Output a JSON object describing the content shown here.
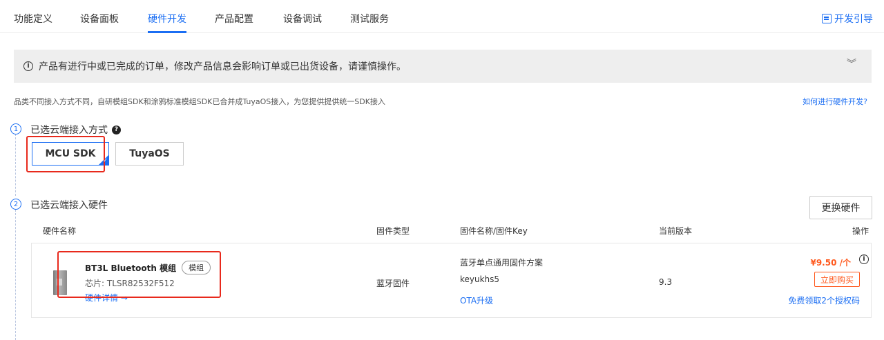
{
  "nav": {
    "tabs": [
      "功能定义",
      "设备面板",
      "硬件开发",
      "产品配置",
      "设备调试",
      "测试服务"
    ],
    "active_index": 2,
    "guide_label": "开发引导"
  },
  "warning": {
    "text": "产品有进行中或已完成的订单，修改产品信息会影响订单或已出货设备，请谨慎操作。"
  },
  "description": "品类不同接入方式不同，自研模组SDK和涂鸦标准模组SDK已合并成TuyaOS接入，为您提供提供统一SDK接入",
  "help_link": "如何进行硬件开发?",
  "step1": {
    "number": "1",
    "title": "已选云端接入方式",
    "help_icon_glyph": "?",
    "options": [
      "MCU SDK",
      "TuyaOS"
    ],
    "selected_option": "MCU SDK"
  },
  "step2": {
    "number": "2",
    "title": "已选云端接入硬件",
    "change_button": "更换硬件",
    "columns": [
      "硬件名称",
      "固件类型",
      "固件名称/固件Key",
      "当前版本",
      "操作"
    ],
    "hardware": {
      "name": "BT3L Bluetooth 模组",
      "badge": "模组",
      "chip": "芯片: TLSR82532F512",
      "detail_link": "硬件详情 →",
      "firmware_type": "蓝牙固件",
      "firmware_name": "蓝牙单点通用固件方案",
      "firmware_key": "keyukhs5",
      "ota_link": "OTA升级",
      "version": "9.3",
      "price": "¥9.50 /个",
      "buy_button": "立即购买",
      "free_link": "免费领取2个授权码"
    }
  },
  "colors": {
    "accent": "#1b6ef3",
    "price": "#ff5a1f",
    "highlight_box": "#e8291c",
    "warning_bg": "#eeeeee"
  }
}
